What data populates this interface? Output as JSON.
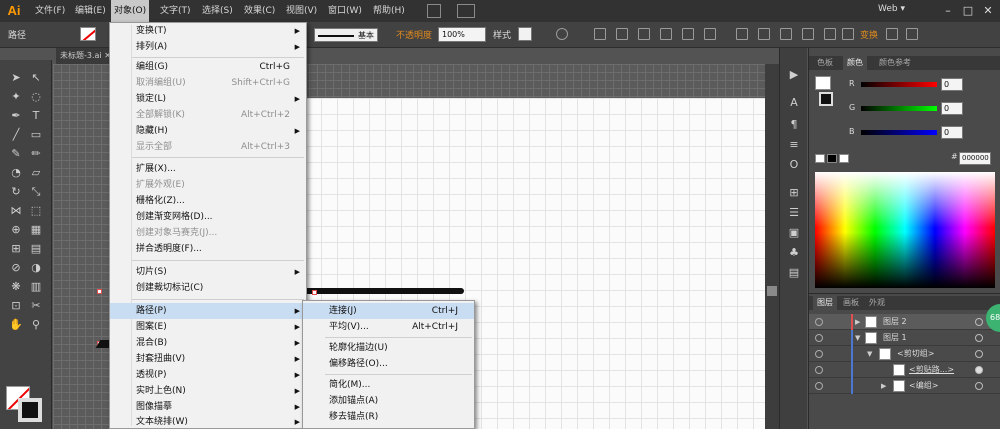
{
  "app": {
    "logo": "Ai",
    "workspace": "Web"
  },
  "menubar": [
    "文件(F)",
    "编辑(E)",
    "对象(O)",
    "文字(T)",
    "选择(S)",
    "效果(C)",
    "视图(V)",
    "窗口(W)",
    "帮助(H)"
  ],
  "control_bar": {
    "label": "路径",
    "stroke_preset": "基本",
    "opacity_label": "不透明度",
    "opacity_value": "100%",
    "style_label": "样式",
    "transform_label": "变换"
  },
  "document_tab": "未标题-3.ai",
  "object_menu": [
    {
      "label": "变换(T)",
      "shortcut": "",
      "submenu": true,
      "disabled": false
    },
    {
      "label": "排列(A)",
      "shortcut": "",
      "submenu": true,
      "disabled": false
    },
    {
      "label": "编组(G)",
      "shortcut": "Ctrl+G",
      "submenu": false,
      "disabled": false
    },
    {
      "label": "取消编组(U)",
      "shortcut": "Shift+Ctrl+G",
      "submenu": false,
      "disabled": true
    },
    {
      "label": "锁定(L)",
      "shortcut": "",
      "submenu": true,
      "disabled": false
    },
    {
      "label": "全部解锁(K)",
      "shortcut": "Alt+Ctrl+2",
      "submenu": false,
      "disabled": true
    },
    {
      "label": "隐藏(H)",
      "shortcut": "",
      "submenu": true,
      "disabled": false
    },
    {
      "label": "显示全部",
      "shortcut": "Alt+Ctrl+3",
      "submenu": false,
      "disabled": true
    },
    {
      "label": "扩展(X)...",
      "shortcut": "",
      "submenu": false,
      "disabled": false
    },
    {
      "label": "扩展外观(E)",
      "shortcut": "",
      "submenu": false,
      "disabled": true
    },
    {
      "label": "栅格化(Z)...",
      "shortcut": "",
      "submenu": false,
      "disabled": false
    },
    {
      "label": "创建渐变网格(D)...",
      "shortcut": "",
      "submenu": false,
      "disabled": false
    },
    {
      "label": "创建对象马赛克(J)...",
      "shortcut": "",
      "submenu": false,
      "disabled": true
    },
    {
      "label": "拼合透明度(F)...",
      "shortcut": "",
      "submenu": false,
      "disabled": false
    },
    {
      "label": "切片(S)",
      "shortcut": "",
      "submenu": true,
      "disabled": false
    },
    {
      "label": "创建裁切标记(C)",
      "shortcut": "",
      "submenu": false,
      "disabled": false
    },
    {
      "label": "路径(P)",
      "shortcut": "",
      "submenu": true,
      "disabled": false
    },
    {
      "label": "图案(E)",
      "shortcut": "",
      "submenu": true,
      "disabled": false
    },
    {
      "label": "混合(B)",
      "shortcut": "",
      "submenu": true,
      "disabled": false
    },
    {
      "label": "封套扭曲(V)",
      "shortcut": "",
      "submenu": true,
      "disabled": false
    },
    {
      "label": "透视(P)",
      "shortcut": "",
      "submenu": true,
      "disabled": false
    },
    {
      "label": "实时上色(N)",
      "shortcut": "",
      "submenu": true,
      "disabled": false
    },
    {
      "label": "图像描摹",
      "shortcut": "",
      "submenu": true,
      "disabled": false
    },
    {
      "label": "文本绕排(W)",
      "shortcut": "",
      "submenu": true,
      "disabled": false
    }
  ],
  "path_submenu": [
    {
      "label": "连接(J)",
      "shortcut": "Ctrl+J"
    },
    {
      "label": "平均(V)...",
      "shortcut": "Alt+Ctrl+J"
    },
    {
      "label": "轮廓化描边(U)",
      "shortcut": ""
    },
    {
      "label": "偏移路径(O)...",
      "shortcut": ""
    },
    {
      "label": "简化(M)...",
      "shortcut": ""
    },
    {
      "label": "添加锚点(A)",
      "shortcut": ""
    },
    {
      "label": "移去锚点(R)",
      "shortcut": ""
    }
  ],
  "color_panel": {
    "tabs": [
      "色板",
      "颜色",
      "颜色参考"
    ],
    "r_label": "R",
    "g_label": "G",
    "b_label": "B",
    "r": "0",
    "g": "0",
    "b": "0",
    "hex_label": "#",
    "hex": "000000"
  },
  "layers_panel": {
    "tabs": [
      "图层",
      "画板",
      "外观"
    ],
    "rows": [
      {
        "name": "图层 2"
      },
      {
        "name": "图层 1"
      },
      {
        "name": "<剪切组>"
      },
      {
        "name": "<剪贴路...>"
      },
      {
        "name": "<编组>"
      }
    ],
    "badge": "68"
  },
  "colors": {
    "accent": "#e08a1e",
    "highlight": "#c8dcf2",
    "menubar_bg": "#323232"
  }
}
